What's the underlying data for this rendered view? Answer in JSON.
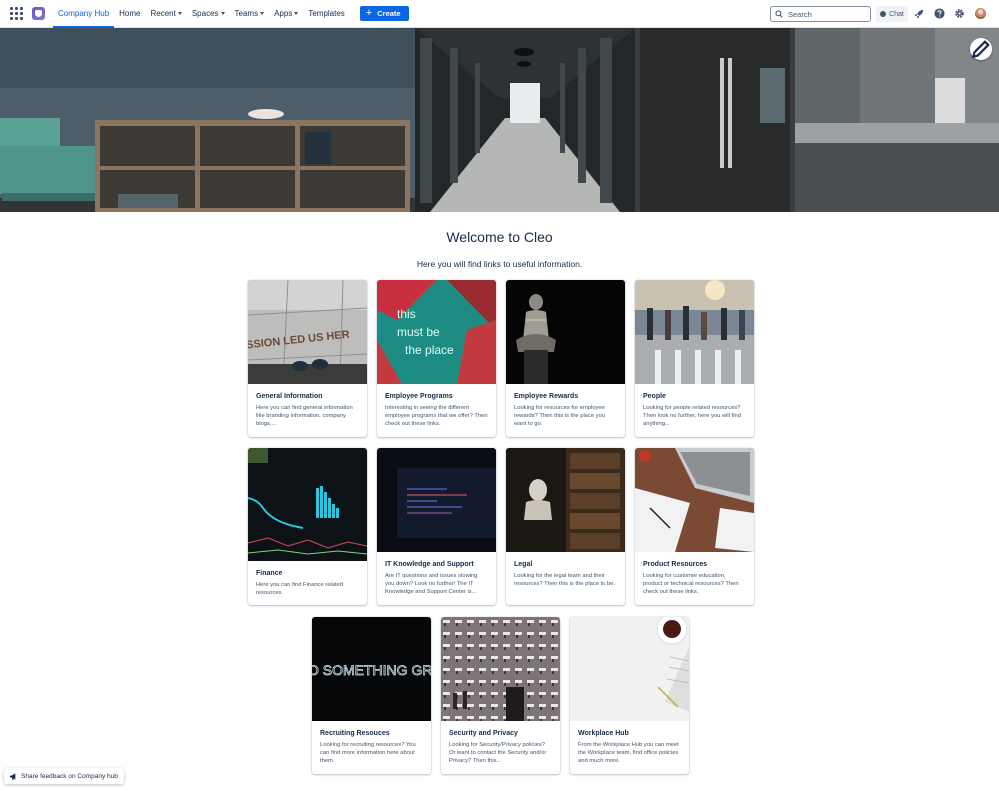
{
  "nav": {
    "items": [
      {
        "label": "Company Hub",
        "caret": false,
        "active": true
      },
      {
        "label": "Home",
        "caret": false,
        "active": false
      },
      {
        "label": "Recent",
        "caret": true,
        "active": false
      },
      {
        "label": "Spaces",
        "caret": true,
        "active": false
      },
      {
        "label": "Teams",
        "caret": true,
        "active": false
      },
      {
        "label": "Apps",
        "caret": true,
        "active": false
      },
      {
        "label": "Templates",
        "caret": false,
        "active": false
      }
    ],
    "create_label": "Create",
    "search_placeholder": "Search",
    "chat_label": "Chat",
    "accent_color": "#0c66e4"
  },
  "icons": {
    "apps": "apps-grid-icon",
    "logo": "confluence-logo-icon",
    "search": "search-icon",
    "chat": "chat-icon",
    "notifications": "rocket-icon",
    "help": "help-icon",
    "settings": "gear-icon",
    "edit": "pencil-icon",
    "feedback": "megaphone-icon"
  },
  "main": {
    "title": "Welcome to Cleo",
    "subtitle": "Here you will find links to useful information."
  },
  "cards": [
    {
      "title": "General Information",
      "desc": "Here you can find general information like branding information, company blogs,..."
    },
    {
      "title": "Employee Programs",
      "desc": "Interesting in seeing the different employee programs that we offer? Then check out these links."
    },
    {
      "title": "Employee Rewards",
      "desc": "Looking for resources for employee rewards? Then this is the place you want to go."
    },
    {
      "title": "People",
      "desc": "Looking for people related resources? Then look no further, here you will find anything..."
    },
    {
      "title": "Finance",
      "desc": "Here you can find Finance related resources."
    },
    {
      "title": "IT Knowledge and Support",
      "desc": "Are IT questions and issues slowing you down? Look no further! The IT Knowledge and Support Center is..."
    },
    {
      "title": "Legal",
      "desc": "Looking for the legal team and their resources? Then this is the place to be."
    },
    {
      "title": "Product Resources",
      "desc": "Looking for customer education, product or technical resources? Then check out these links."
    },
    {
      "title": "Recruiting Resouces",
      "desc": "Looking for recruiting resources? You can find more information here about them."
    },
    {
      "title": "Security and Privacy",
      "desc": "Looking for Security/Privacy policies? Or want to contact the Security and/or Privacy? Then this..."
    },
    {
      "title": "Workplace Hub",
      "desc": "From the Workplace Hub you can meet the Workplace team, find office policies and much more."
    }
  ],
  "card_images": {
    "general": {
      "text": "SSION LED US HER"
    },
    "programs": {
      "line1": "this",
      "line2": "must be",
      "line3": "the place"
    },
    "recruiting": {
      "text": "O SOMETHING GREAT"
    }
  },
  "feedback_label": "Share feedback on Company hub"
}
